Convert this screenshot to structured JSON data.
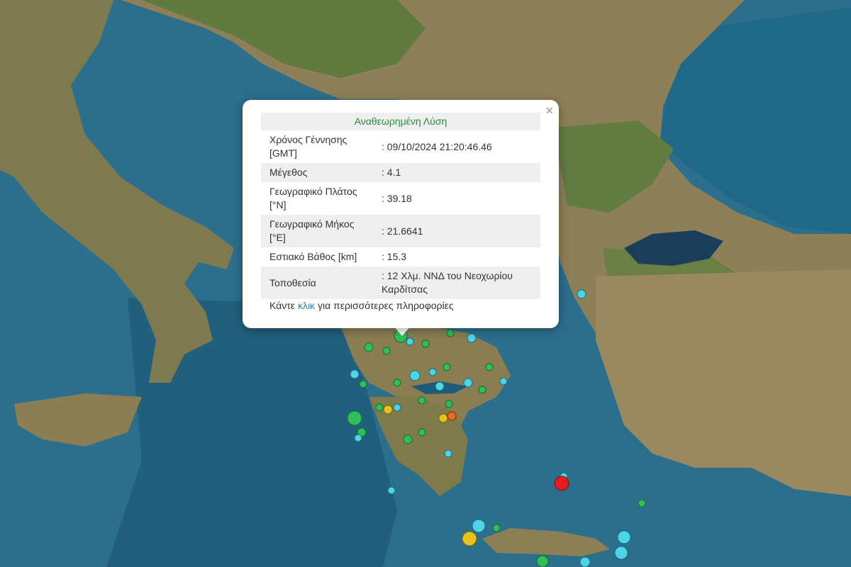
{
  "map": {
    "colors": {
      "sea": "#2c6f8c",
      "deep_sea": "#1f5a77",
      "land": "#9a8a62",
      "forest": "#5c7a3c",
      "lake": "#1c3d5a"
    },
    "marker_colors": {
      "cyan": "#4fd4e6",
      "green": "#2fbf5a",
      "yellow": "#e6c21a",
      "orange": "#e56a1c",
      "red": "#e31d1d"
    }
  },
  "popup": {
    "title": "Αναθεωρημένη Λύση",
    "close": "×",
    "rows": [
      {
        "label": "Χρόνος Γέννησης [GMT]",
        "value": ": 09/10/2024 21:20:46.46"
      },
      {
        "label": "Μέγεθος",
        "value": ": 4.1"
      },
      {
        "label": "Γεωγραφικό Πλάτος [°N]",
        "value": ": 39.18"
      },
      {
        "label": "Γεωγραφικό Μήκος [°E]",
        "value": ": 21.6641"
      },
      {
        "label": "Εστιακό Βάθος [km]",
        "value": ": 15.3"
      },
      {
        "label": "Τοποθεσία",
        "value": ": 12 Χλμ. ΝΝΔ του Νεοχωρίου Καρδίτσας"
      }
    ],
    "more_prefix": "Κάντε",
    "more_link": "κλικ",
    "more_suffix": "για περισσότερες πληροφορίες"
  }
}
